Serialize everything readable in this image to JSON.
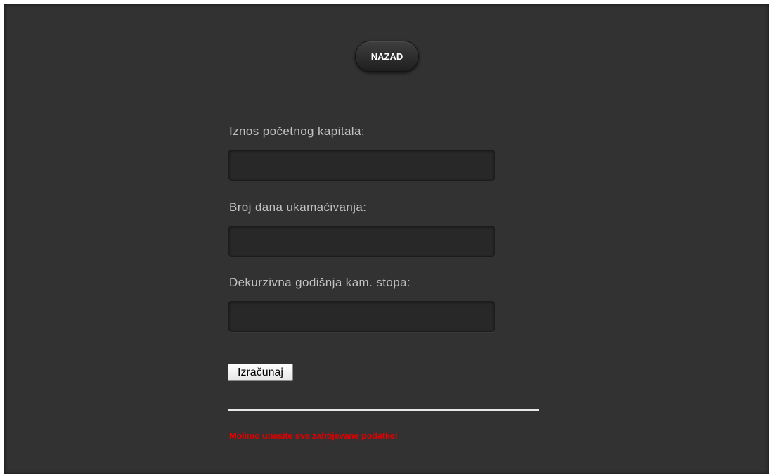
{
  "nav": {
    "back_label": "NAZAD"
  },
  "form": {
    "capital_label": "Iznos početnog kapitala:",
    "capital_value": "",
    "days_label": "Broj dana ukamaćivanja:",
    "days_value": "",
    "rate_label": "Dekurzivna godišnja kam. stopa:",
    "rate_value": "",
    "submit_label": "Izračunaj"
  },
  "result": {
    "error_message": "Molimo unesite sve zahtijevane podatke!"
  },
  "colors": {
    "background": "#323232",
    "error": "#e00000",
    "label": "#c2c2c2"
  }
}
